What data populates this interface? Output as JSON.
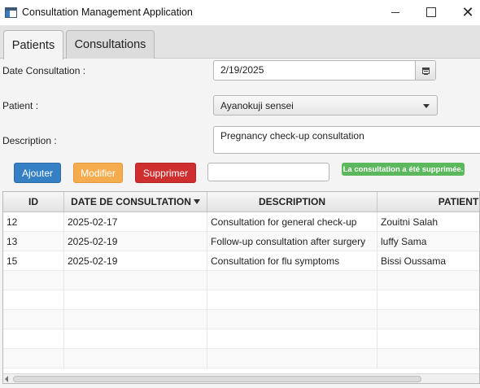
{
  "window": {
    "title": "Consultation Management Application",
    "close_glyph": "✕"
  },
  "tabs": [
    {
      "label": "Patients"
    },
    {
      "label": "Consultations"
    }
  ],
  "form": {
    "date_label": "Date Consultation :",
    "date_value": "2/19/2025",
    "patient_label": "Patient :",
    "patient_selected": "Ayanokuji sensei",
    "description_label": "Description :",
    "description_value": "Pregnancy check-up consultation"
  },
  "toolbar": {
    "add_label": "Ajouter",
    "edit_label": "Modifier",
    "delete_label": "Supprimer",
    "search_value": "",
    "status_message": "La consultation a été supprimée.",
    "status_color": "#5cb85c"
  },
  "table": {
    "columns": [
      "ID",
      "DATE DE CONSULTATION",
      "DESCRIPTION",
      "PATIENT"
    ],
    "sorted_column": "DATE DE CONSULTATION",
    "rows": [
      {
        "id": "12",
        "date": "2025-02-17",
        "description": "Consultation for general check-up",
        "patient": "Zouitni Salah"
      },
      {
        "id": "13",
        "date": "2025-02-19",
        "description": "Follow-up consultation after surgery",
        "patient": "luffy Sama"
      },
      {
        "id": "15",
        "date": "2025-02-19",
        "description": "Consultation for flu symptoms",
        "patient": "Bissi Oussama"
      }
    ]
  },
  "colors": {
    "add_button": "#357fc4",
    "edit_button": "#f4ac4f",
    "delete_button": "#cf2e2e"
  }
}
